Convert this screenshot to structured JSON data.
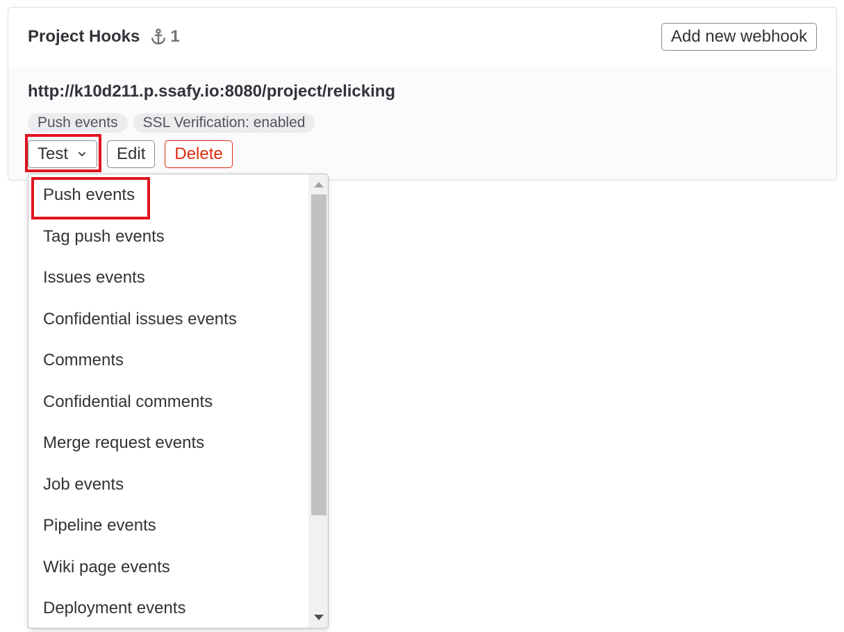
{
  "header": {
    "title": "Project Hooks",
    "hook_count": "1",
    "add_button": "Add new webhook"
  },
  "hook": {
    "url": "http://k10d211.p.ssafy.io:8080/project/relicking",
    "badges": [
      "Push events",
      "SSL Verification: enabled"
    ],
    "test_label": "Test",
    "edit_label": "Edit",
    "delete_label": "Delete"
  },
  "dropdown": {
    "items": [
      "Push events",
      "Tag push events",
      "Issues events",
      "Confidential issues events",
      "Comments",
      "Confidential comments",
      "Merge request events",
      "Job events",
      "Pipeline events",
      "Wiki page events",
      "Deployment events"
    ]
  },
  "colors": {
    "highlight": "#e0141e",
    "danger": "#dd2b0e",
    "text": "#333238"
  }
}
